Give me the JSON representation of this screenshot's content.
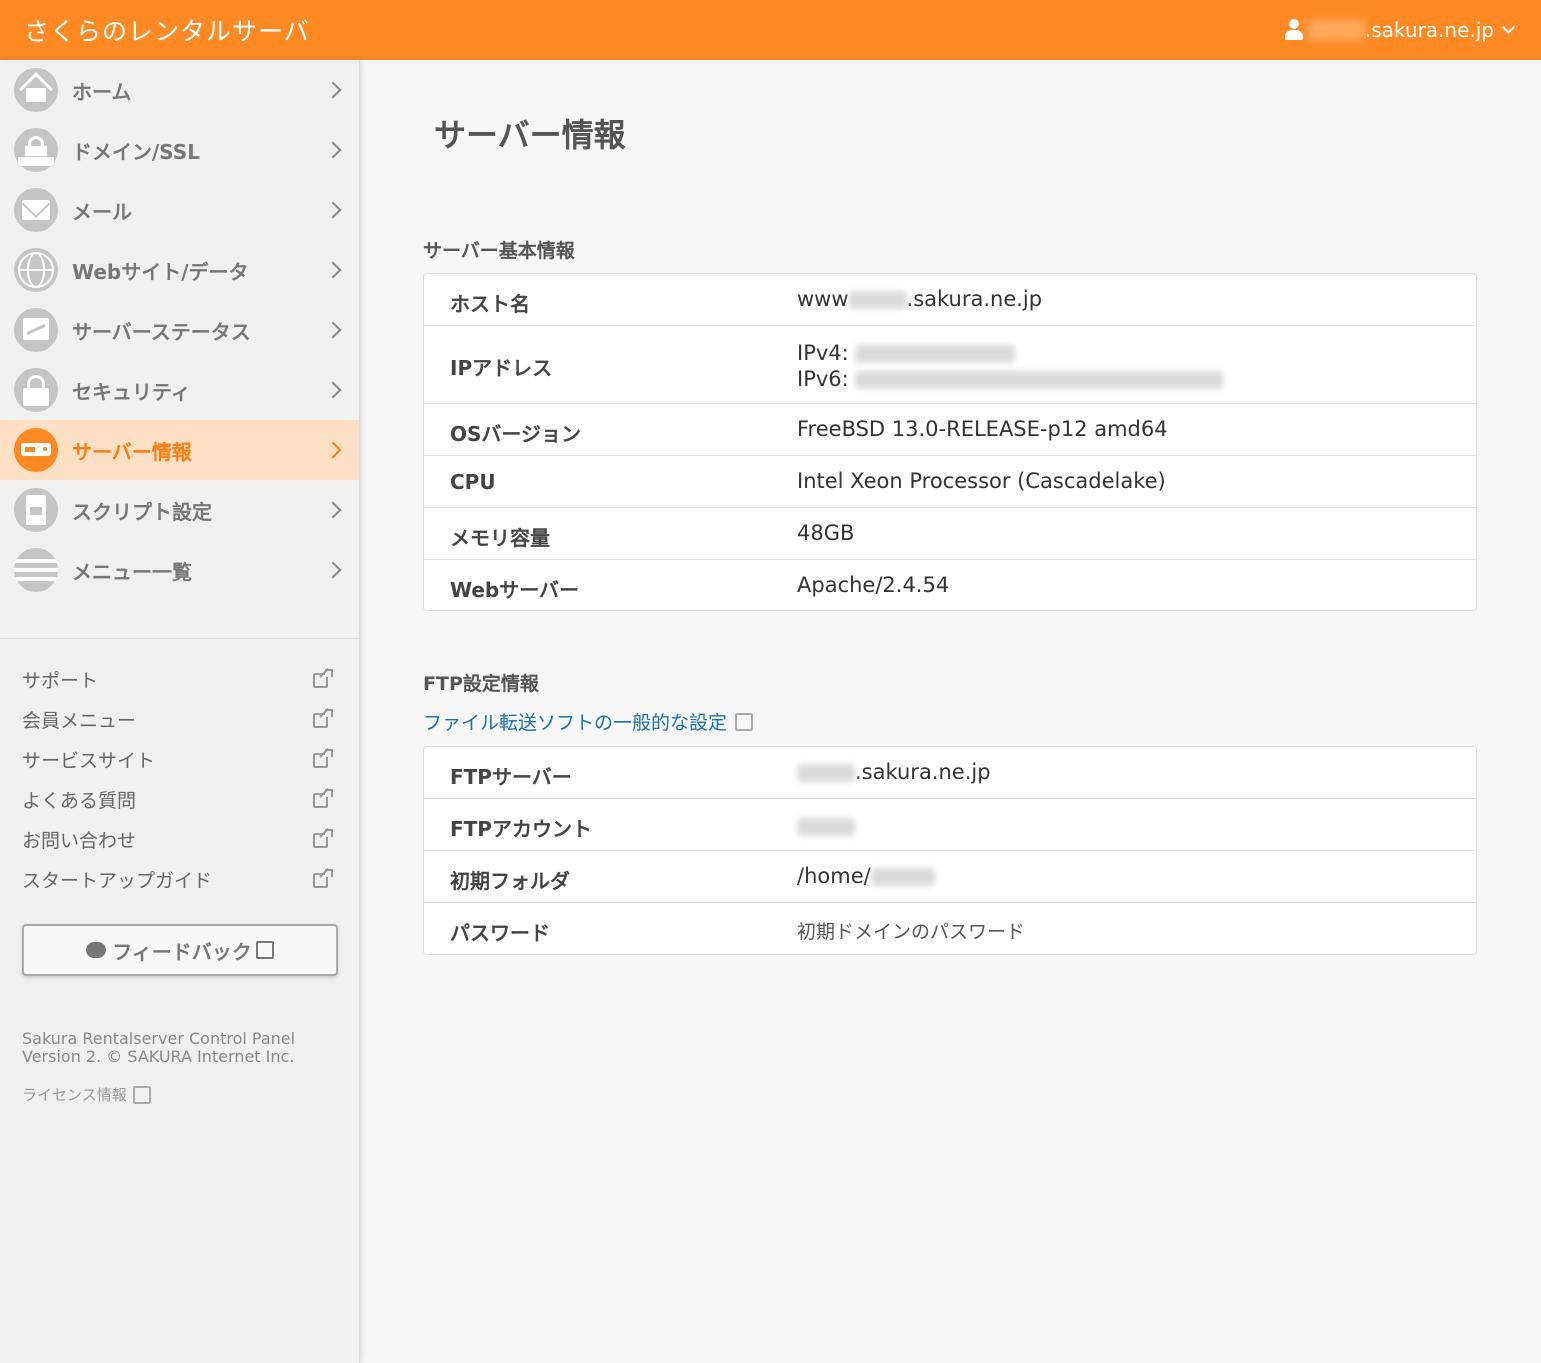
{
  "header": {
    "brand": "さくらのレンタルサーバ",
    "account_suffix": ".sakura.ne.jp"
  },
  "sidebar": {
    "items": [
      {
        "label": "ホーム",
        "icon": "home-icon"
      },
      {
        "label": "ドメイン/SSL",
        "icon": "domain-lock-icon"
      },
      {
        "label": "メール",
        "icon": "mail-icon"
      },
      {
        "label": "Webサイト/データ",
        "icon": "globe-icon"
      },
      {
        "label": "サーバーステータス",
        "icon": "chart-icon"
      },
      {
        "label": "セキュリティ",
        "icon": "lock-icon"
      },
      {
        "label": "サーバー情報",
        "icon": "server-icon",
        "active": true
      },
      {
        "label": "スクリプト設定",
        "icon": "script-file-icon"
      },
      {
        "label": "メニュー一覧",
        "icon": "menu-list-icon"
      }
    ],
    "external_links": [
      "サポート",
      "会員メニュー",
      "サービスサイト",
      "よくある質問",
      "お問い合わせ",
      "スタートアップガイド"
    ],
    "feedback_label": "フィードバック",
    "copyright_line1": "Sakura Rentalserver Control Panel",
    "copyright_line2": "Version 2. © SAKURA Internet Inc.",
    "license_label": "ライセンス情報"
  },
  "main": {
    "page_title": "サーバー情報",
    "basic": {
      "title": "サーバー基本情報",
      "rows": [
        {
          "key": "ホスト名",
          "val_prefix": "www",
          "val_suffix": ".sakura.ne.jp"
        },
        {
          "key": "IPアドレス",
          "ipv4_label": "IPv4:",
          "ipv6_label": "IPv6:"
        },
        {
          "key": "OSバージョン",
          "val": "FreeBSD 13.0-RELEASE-p12 amd64"
        },
        {
          "key": "CPU",
          "val": "Intel Xeon Processor (Cascadelake)"
        },
        {
          "key": "メモリ容量",
          "val": "48GB"
        },
        {
          "key": "Webサーバー",
          "val": "Apache/2.4.54"
        }
      ]
    },
    "ftp": {
      "title": "FTP設定情報",
      "link": "ファイル転送ソフトの一般的な設定",
      "rows": [
        {
          "key": "FTPサーバー",
          "val_suffix": ".sakura.ne.jp"
        },
        {
          "key": "FTPアカウント"
        },
        {
          "key": "初期フォルダ",
          "val_prefix": "/home/"
        },
        {
          "key": "パスワード",
          "val": "初期ドメインのパスワード"
        }
      ]
    }
  },
  "colors": {
    "brand_orange": "#ff8a25",
    "active_bg": "#fde0c4",
    "link_blue": "#1a6fb5"
  }
}
